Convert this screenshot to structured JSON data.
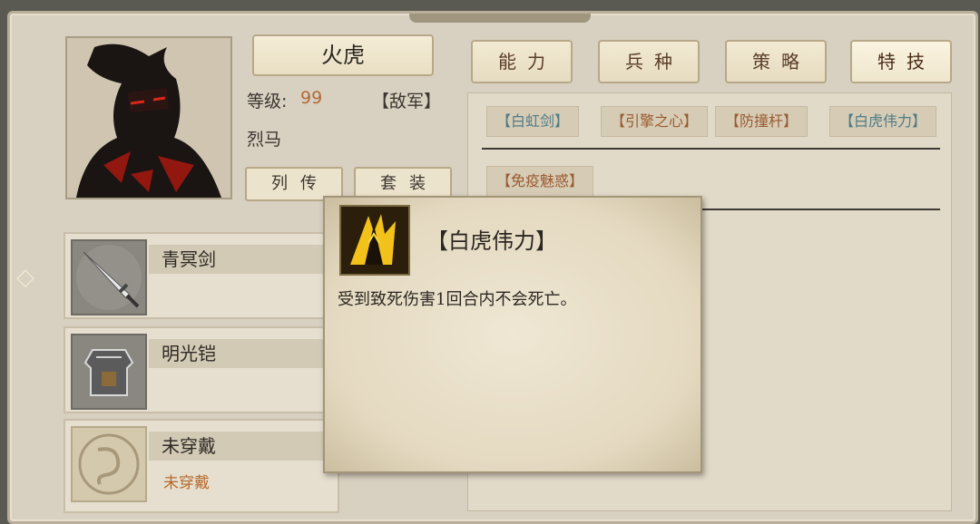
{
  "general": {
    "name": "火虎",
    "level_label": "等级:",
    "level_value": "99",
    "faction": "【敌军】",
    "horse": "烈马"
  },
  "buttons": {
    "biography": "列传",
    "suit": "套装"
  },
  "tabs": [
    "能力",
    "兵种",
    "策略",
    "特技"
  ],
  "skills": {
    "row1": [
      "【白虹剑】",
      "【引擎之心】",
      "【防撞杆】",
      "【白虎伟力】"
    ],
    "row2": [
      "【免疫魅惑】"
    ]
  },
  "equipment": [
    {
      "name": "青冥剑",
      "icon": "sword-icon",
      "sub": ""
    },
    {
      "name": "明光铠",
      "icon": "armor-icon",
      "sub": ""
    },
    {
      "name": "未穿戴",
      "icon": "dragon-emblem-icon",
      "sub": "未穿戴"
    }
  ],
  "tooltip": {
    "title": "【白虎伟力】",
    "description": "受到致死伤害1回合内不会死亡。",
    "icon": "white-tiger-might-icon"
  },
  "colors": {
    "accent_orange": "#b06a3a",
    "skill_teal": "#4f7a85",
    "skill_brown": "#9a5a30"
  }
}
